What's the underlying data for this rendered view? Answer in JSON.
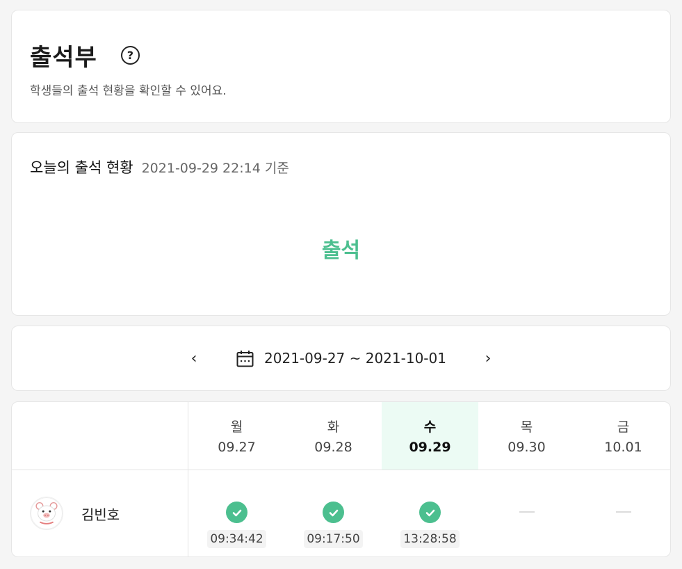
{
  "header": {
    "title": "출석부",
    "help_icon": "help-circle-icon",
    "help_glyph": "?",
    "subtitle": "학생들의 출석 현황을 확인할 수 있어요."
  },
  "today": {
    "label": "오늘의 출석 현황",
    "timestamp": "2021-09-29 22:14 기준",
    "status": "출석",
    "status_color": "#4cbf8f"
  },
  "week": {
    "prev": "‹",
    "next": "›",
    "range": "2021-09-27 ~ 2021-10-01",
    "calendar_icon": "calendar-icon"
  },
  "table": {
    "days": [
      {
        "name": "월",
        "date": "09.27"
      },
      {
        "name": "화",
        "date": "09.28"
      },
      {
        "name": "수",
        "date": "09.29"
      },
      {
        "name": "목",
        "date": "09.30"
      },
      {
        "name": "금",
        "date": "10.01"
      }
    ],
    "highlight_color": "#ecfbf4",
    "rows": [
      {
        "name": "김빈호",
        "avatar": "pig-avatar-icon",
        "attendance": [
          {
            "status": "present",
            "time": "09:34:42"
          },
          {
            "status": "present",
            "time": "09:17:50"
          },
          {
            "status": "present",
            "time": "13:28:58"
          },
          {
            "status": "none"
          },
          {
            "status": "none"
          }
        ]
      }
    ]
  }
}
